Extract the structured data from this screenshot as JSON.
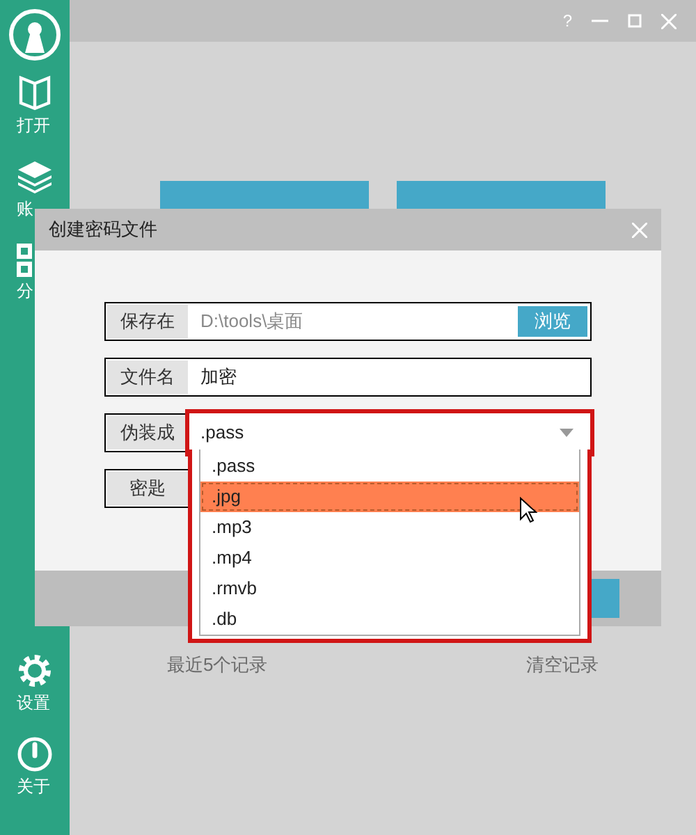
{
  "window": {
    "help": "?"
  },
  "sidebar": {
    "items": [
      {
        "kind": "book",
        "label": "打开"
      },
      {
        "kind": "layers",
        "label": "账"
      },
      {
        "kind": "grid",
        "label": "分"
      }
    ],
    "bottom_items": [
      {
        "kind": "gear",
        "label": "设置"
      },
      {
        "kind": "info",
        "label": "关于"
      }
    ]
  },
  "main": {
    "footer_links": [
      "最近5个记录",
      "清空记录"
    ]
  },
  "dialog": {
    "title": "创建密码文件",
    "rows": [
      {
        "kind": "path",
        "label": "保存在",
        "value": "D:\\tools\\桌面",
        "button": "浏览"
      },
      {
        "kind": "text",
        "label": "文件名",
        "value": "加密"
      },
      {
        "kind": "select",
        "label": "伪装成",
        "value": ".pass",
        "expanded": true
      },
      {
        "kind": "hidden",
        "label": "密匙"
      }
    ],
    "options": [
      {
        "label": ".pass",
        "selected": false
      },
      {
        "label": ".jpg",
        "selected": true
      },
      {
        "label": ".mp3",
        "selected": false
      },
      {
        "label": ".mp4",
        "selected": false
      },
      {
        "label": ".rmvb",
        "selected": false
      },
      {
        "label": ".db",
        "selected": false
      }
    ]
  }
}
